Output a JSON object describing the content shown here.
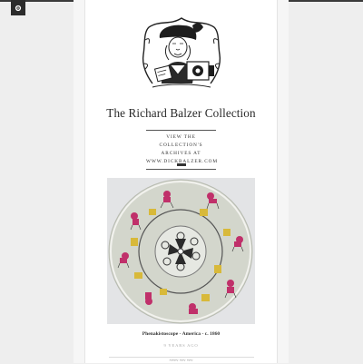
{
  "site": {
    "title": "The Richard Balzer Collection",
    "description_lines": [
      "VIEW THE COLLECTION'S",
      "ARCHIVES AT",
      "WWW.DICKBALZER.COM"
    ]
  },
  "post": {
    "caption": "Phenakistoscope - America - c. 1860",
    "timestamp": "9 YEARS AGO",
    "next_title_partial": "~~~ ~~ ~~"
  },
  "icons": {
    "corner": "settings-icon"
  },
  "colors": {
    "page_bg": "#eeeeee",
    "column_bg": "#ffffff",
    "text": "#2a2a2a",
    "muted": "#aaaaaa",
    "disc": "#cfd3c6",
    "figure_red": "#c0306a",
    "figure_yellow": "#d8b93a"
  }
}
